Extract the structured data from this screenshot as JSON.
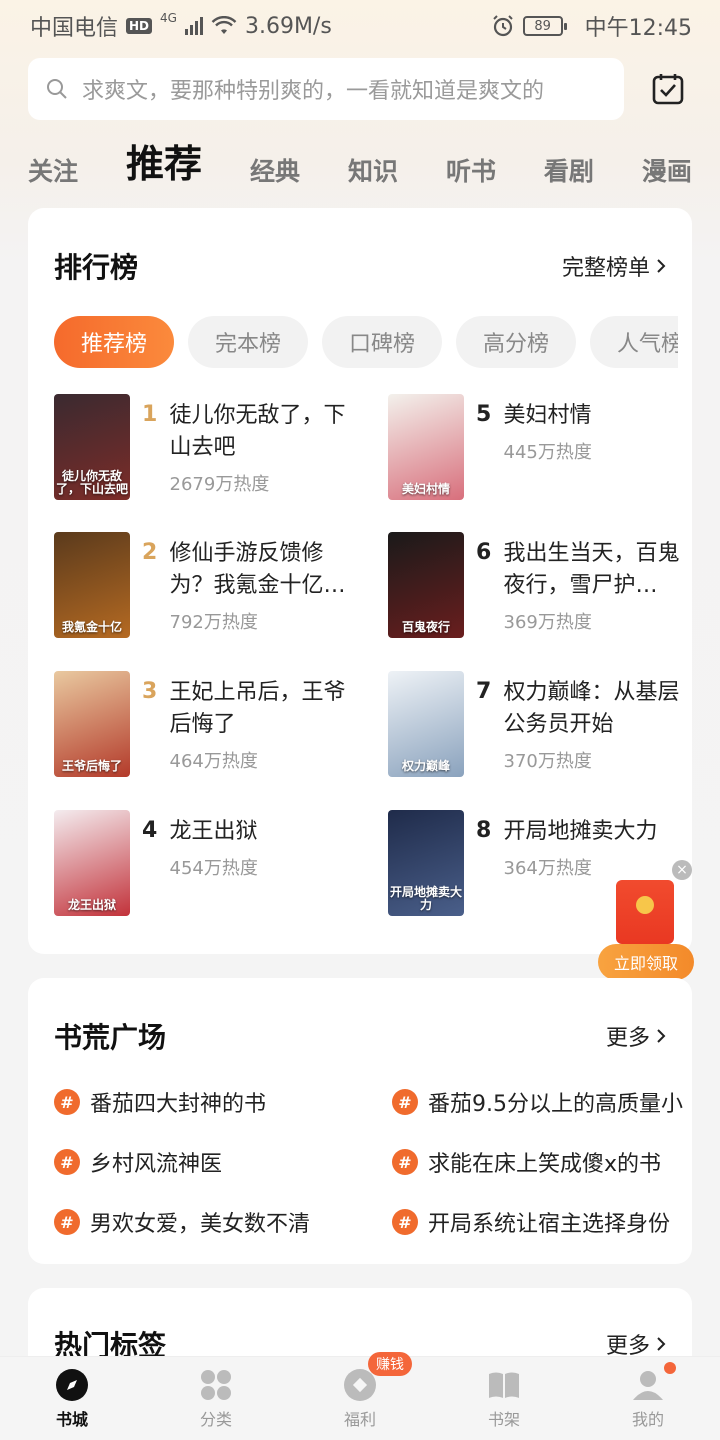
{
  "status_bar": {
    "carrier": "中国电信",
    "hd": "HD",
    "network": "4G",
    "speed": "3.69M/s",
    "battery": "89",
    "time": "中午12:45"
  },
  "search": {
    "placeholder": "求爽文，要那种特别爽的，一看就知道是爽文的"
  },
  "tabs": [
    {
      "label": "关注"
    },
    {
      "label": "推荐"
    },
    {
      "label": "经典"
    },
    {
      "label": "知识"
    },
    {
      "label": "听书"
    },
    {
      "label": "看剧"
    },
    {
      "label": "漫画"
    }
  ],
  "ranking": {
    "title": "排行榜",
    "more": "完整榜单",
    "chips": [
      "推荐榜",
      "完本榜",
      "口碑榜",
      "高分榜",
      "人气榜"
    ],
    "books": [
      {
        "rank": "1",
        "title": "徒儿你无敌了，下山去吧",
        "heat": "2679万热度",
        "cover_text": "徒儿你无敌了，下山去吧",
        "colors": [
          "#3a2a30",
          "#7d2c28"
        ]
      },
      {
        "rank": "2",
        "title": "修仙手游反馈修为？我氪金十亿…",
        "heat": "792万热度",
        "cover_text": "我氪金十亿",
        "colors": [
          "#5a3a1c",
          "#b56a22"
        ]
      },
      {
        "rank": "3",
        "title": "王妃上吊后，王爷后悔了",
        "heat": "464万热度",
        "cover_text": "王爷后悔了",
        "colors": [
          "#e9c9a0",
          "#b33a2a"
        ]
      },
      {
        "rank": "4",
        "title": "龙王出狱",
        "heat": "454万热度",
        "cover_text": "龙王出狱",
        "colors": [
          "#f4ecef",
          "#c2323a"
        ]
      },
      {
        "rank": "5",
        "title": "美妇村情",
        "heat": "445万热度",
        "cover_text": "美妇村情",
        "colors": [
          "#f3f1ec",
          "#d86f7c"
        ]
      },
      {
        "rank": "6",
        "title": "我出生当天，百鬼夜行，雪尸护…",
        "heat": "369万热度",
        "cover_text": "百鬼夜行",
        "colors": [
          "#1a1a1a",
          "#6a1e1e"
        ]
      },
      {
        "rank": "7",
        "title": "权力巅峰：从基层公务员开始",
        "heat": "370万热度",
        "cover_text": "权力巅峰",
        "colors": [
          "#eef2f6",
          "#8aa2bd"
        ]
      },
      {
        "rank": "8",
        "title": "开局地摊卖大力",
        "heat": "364万热度",
        "cover_text": "开局地摊卖大力",
        "colors": [
          "#1f2b4a",
          "#4a5f8a"
        ]
      }
    ]
  },
  "gift": {
    "close": "×",
    "label": "立即领取"
  },
  "book_square": {
    "title": "书荒广场",
    "more": "更多",
    "topics": [
      "番茄四大封神的书",
      "番茄9.5分以上的高质量小",
      "乡村风流神医",
      "求能在床上笑成傻x的书",
      "男欢女爱，美女数不清",
      "开局系统让宿主选择身份"
    ]
  },
  "hot_tags": {
    "title": "热门标签",
    "more": "更多"
  },
  "bottom_nav": [
    {
      "label": "书城",
      "icon": "compass-icon"
    },
    {
      "label": "分类",
      "icon": "grid-icon"
    },
    {
      "label": "福利",
      "icon": "coin-icon",
      "badge": "赚钱"
    },
    {
      "label": "书架",
      "icon": "book-icon"
    },
    {
      "label": "我的",
      "icon": "user-icon"
    }
  ],
  "colors": {
    "accent": "#f56a2c",
    "rank_gold": "#d9a45c"
  }
}
